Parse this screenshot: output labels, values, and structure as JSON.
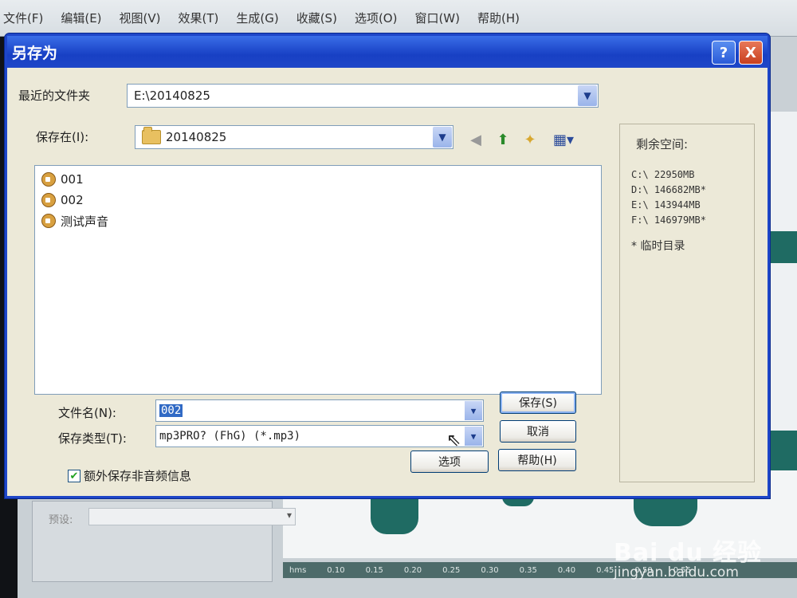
{
  "app": {
    "menu": [
      "文件(F)",
      "编辑(E)",
      "视图(V)",
      "效果(T)",
      "生成(G)",
      "收藏(S)",
      "选项(O)",
      "窗口(W)",
      "帮助(H)"
    ],
    "timeline_ticks": [
      "hms",
      "0.10",
      "0.15",
      "0.20",
      "0.25",
      "0.30",
      "0.35",
      "0.40",
      "0.45",
      "0.50",
      "0.55"
    ],
    "bottom_left_label": "预设:"
  },
  "dialog": {
    "title": "另存为",
    "help_btn": "?",
    "close_btn": "X",
    "recent_label": "最近的文件夹",
    "recent_value": "E:\\20140825",
    "save_in_label": "保存在(I):",
    "save_in_value": "20140825",
    "files": [
      {
        "name": "001"
      },
      {
        "name": "002"
      },
      {
        "name": "测试声音"
      }
    ],
    "free_space": {
      "title": "剩余空间:",
      "drives": [
        "C:\\  22950MB",
        "D:\\  146682MB*",
        "E:\\  143944MB",
        "F:\\  146979MB*"
      ],
      "note": "* 临时目录"
    },
    "filename_label": "文件名(N):",
    "filename_value": "002",
    "filetype_label": "保存类型(T):",
    "filetype_value": "mp3PRO? (FhG) (*.mp3)",
    "save_button": "保存(S)",
    "cancel_button": "取消",
    "options_button": "选项",
    "help_button": "帮助(H)",
    "extra_checkbox_label": "额外保存非音频信息",
    "extra_checkbox_checked": true
  },
  "watermark": {
    "logo": "Bai du 经验",
    "url": "jingyan.baidu.com"
  },
  "colors": {
    "titlebar": "#1e46c8",
    "dialog_bg": "#ece9d8",
    "selection": "#316ac5",
    "wave": "#1f6b63"
  }
}
